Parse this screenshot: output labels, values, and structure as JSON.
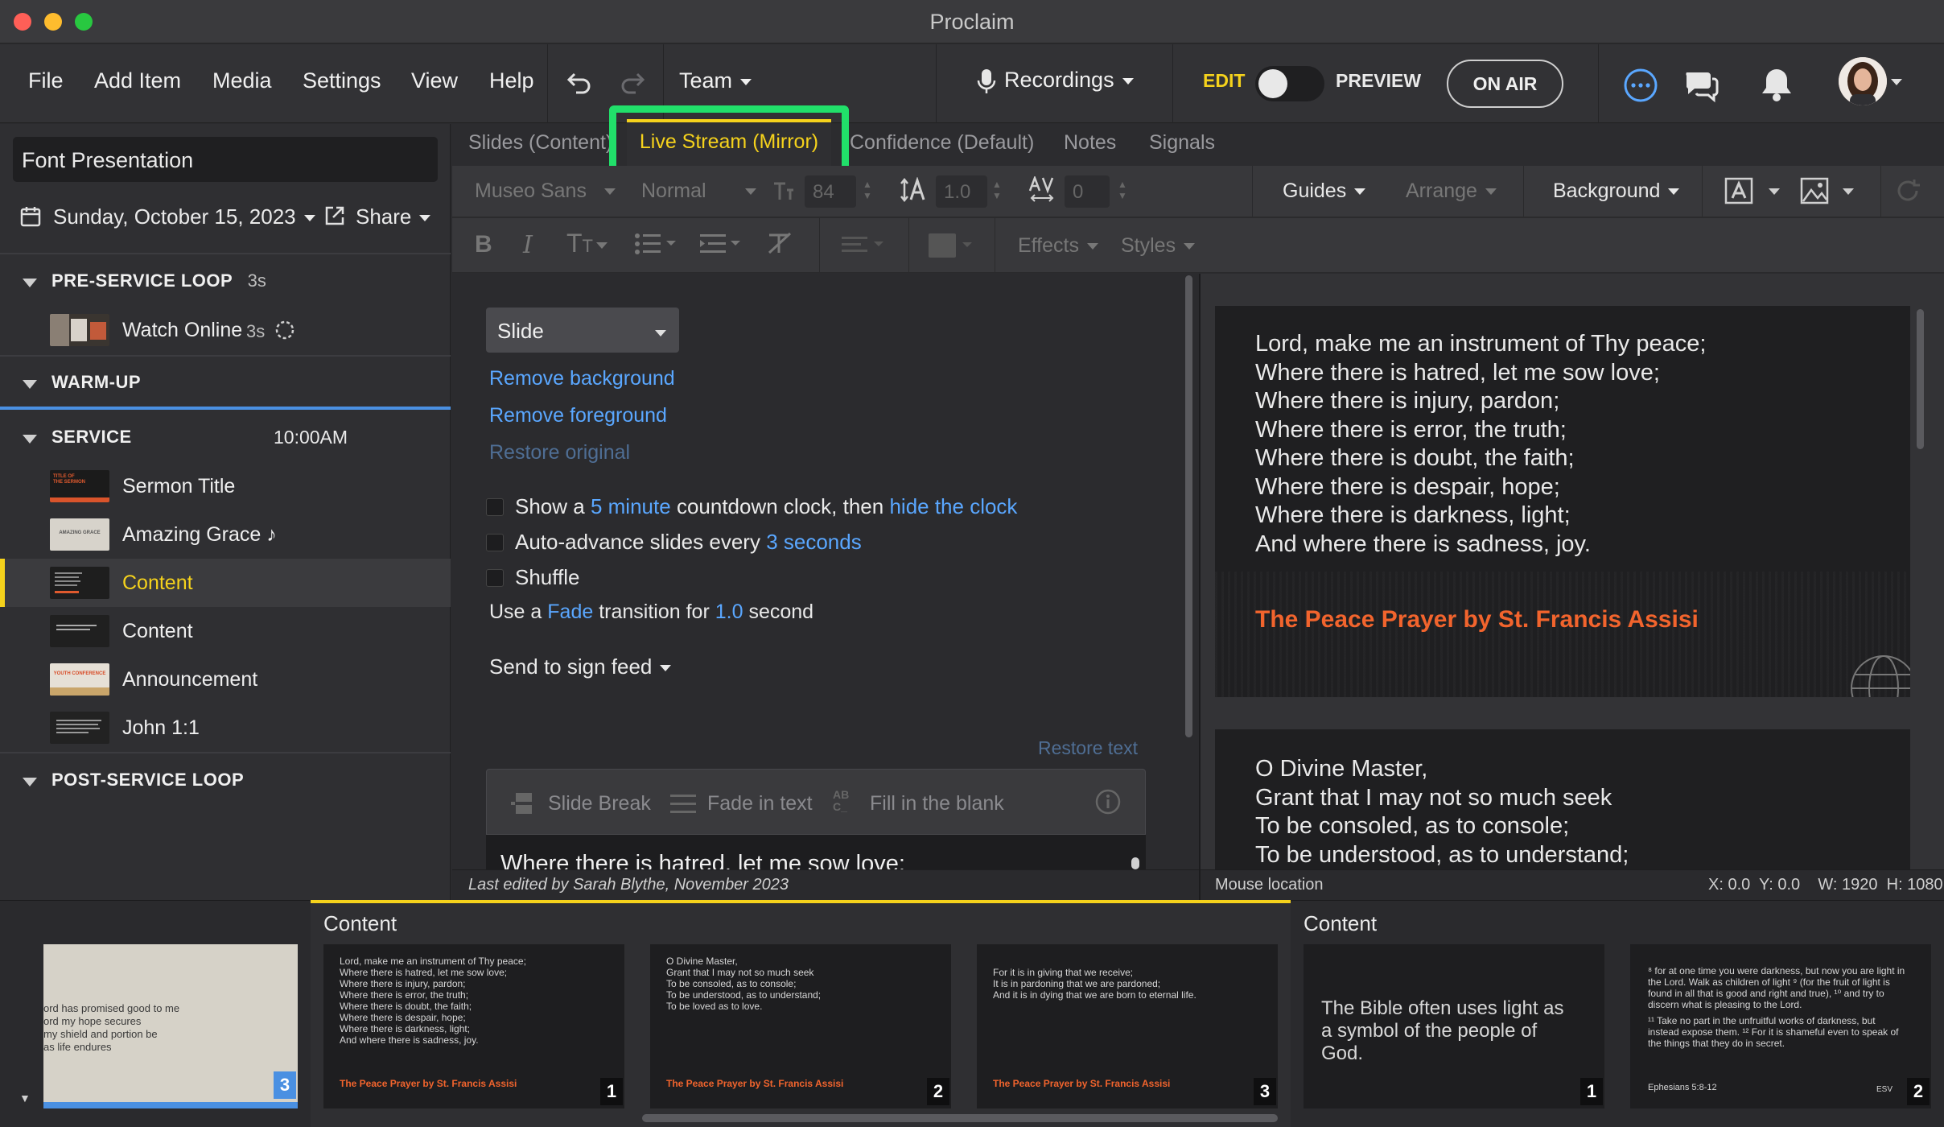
{
  "app": {
    "title": "Proclaim"
  },
  "menu": {
    "file": "File",
    "add_item": "Add Item",
    "media": "Media",
    "settings": "Settings",
    "view": "View",
    "help": "Help",
    "team": "Team",
    "recordings": "Recordings",
    "edit": "EDIT",
    "preview": "PREVIEW",
    "on_air": "ON AIR"
  },
  "colors": {
    "accent_yellow": "#f5d21c",
    "link_blue": "#5aa7ff",
    "on_air_border": "#cfcfcf",
    "highlight_green": "#21e06a",
    "title_orange": "#f2642d"
  },
  "sidebar": {
    "presentation_name": "Font Presentation",
    "date": "Sunday, October 15, 2023",
    "share": "Share",
    "sections": {
      "pre_service": {
        "title": "PRE-SERVICE LOOP",
        "duration": "3s"
      },
      "warm_up": {
        "title": "WARM-UP"
      },
      "service": {
        "title": "SERVICE",
        "time": "10:00AM"
      },
      "post_service": {
        "title": "POST-SERVICE LOOP"
      }
    },
    "pre_service_items": [
      {
        "label": "Watch Online",
        "duration": "3s"
      }
    ],
    "service_items": [
      {
        "label": "Sermon Title"
      },
      {
        "label": "Amazing Grace",
        "badge": "♪"
      },
      {
        "label": "Content"
      },
      {
        "label": "Content"
      },
      {
        "label": "Announcement"
      },
      {
        "label": "John 1:1"
      }
    ],
    "thumb_captions": {
      "sermon": "TITLE OF THE SERMON",
      "grace": "AMAZING GRACE",
      "youth": "YOUTH CONFERENCE"
    }
  },
  "tabs": [
    "Slides (Content)",
    "Live Stream (Mirror)",
    "Confidence (Default)",
    "Notes",
    "Signals"
  ],
  "toolbar": {
    "font": "Museo Sans",
    "weight": "Normal",
    "size": "84",
    "line_height": "1.0",
    "tracking": "0",
    "guides": "Guides",
    "arrange": "Arrange",
    "background": "Background",
    "effects": "Effects",
    "styles": "Styles"
  },
  "editor": {
    "dropdown": "Slide",
    "remove_background": "Remove background",
    "remove_foreground": "Remove foreground",
    "restore_original": "Restore original",
    "countdown": {
      "pre": "Show a",
      "link1": "5 minute",
      "mid": "countdown clock, then",
      "link2": "hide the clock"
    },
    "advance": {
      "pre": "Auto-advance slides every",
      "link": "3 seconds"
    },
    "shuffle": "Shuffle",
    "transition": {
      "pre": "Use a",
      "link1": "Fade",
      "mid": "transition for",
      "link2": "1.0",
      "post": "second"
    },
    "send_sign": "Send to sign feed",
    "restore_text": "Restore text",
    "slide_break": "Slide Break",
    "fade_in_text": "Fade in text",
    "fill_blank": "Fill in the blank",
    "text_preview": "Where there is hatred, let me sow love;"
  },
  "preview": {
    "slide1_lines": [
      "Lord, make me an instrument of Thy peace;",
      "Where there is hatred, let me sow love;",
      "Where there is injury, pardon;",
      "Where there is error, the truth;",
      "Where there is doubt, the faith;",
      "Where there is despair, hope;",
      "Where there is darkness, light;",
      "And where there is sadness, joy."
    ],
    "slide1_title": "The Peace Prayer by St. Francis Assisi",
    "slide2_lines": [
      "O Divine Master,",
      "Grant that I may not so much seek",
      "To be consoled, as to console;",
      "To be understood, as to understand;"
    ]
  },
  "status": {
    "last_edited": "Last edited by Sarah Blythe, November 2023",
    "mouse_location": "Mouse location",
    "coords": "X: 0.0  Y: 0.0    W: 1920  H: 1080"
  },
  "filmstrip": {
    "left_partial": {
      "lines": [
        "ord has promised good to me",
        "ord my hope secures",
        "my shield and portion be",
        "as life endures"
      ],
      "num": "3"
    },
    "group1": {
      "title": "Content",
      "slides": [
        {
          "lines": [
            "Lord, make me an instrument of Thy peace;",
            "Where there is hatred, let me sow love;",
            "Where there is injury, pardon;",
            "Where there is error, the truth;",
            "Where there is doubt, the faith;",
            "Where there is despair, hope;",
            "Where there is darkness, light;",
            "And where there is sadness, joy."
          ],
          "title": "The Peace Prayer by St. Francis Assisi",
          "num": "1"
        },
        {
          "lines": [
            "O Divine Master,",
            "Grant that I may not so much seek",
            "To be consoled, as to console;",
            "To be understood, as to understand;",
            "To be loved as to love."
          ],
          "title": "The Peace Prayer by St. Francis Assisi",
          "num": "2"
        },
        {
          "lines": [
            "For it is in giving that we receive;",
            "It is in pardoning that we are pardoned;",
            "And it is in dying that we are born to eternal life."
          ],
          "title": "The Peace Prayer by St. Francis Assisi",
          "num": "3"
        }
      ]
    },
    "group2": {
      "title": "Content",
      "slides": [
        {
          "text": "The Bible often uses light as a symbol of the people of God.",
          "num": "1"
        },
        {
          "lines": [
            "⁸ for at one time you were darkness, but now you are light in",
            "the Lord. Walk as children of light ⁹ (for the fruit of light is",
            "found in all that is good and right and true), ¹⁰ and try to",
            "discern what is pleasing to the Lord.",
            "",
            "¹¹ Take no part in the unfruitful works of darkness, but",
            "instead expose them. ¹² For it is shameful even to speak of",
            "the things that they do in secret."
          ],
          "ref": "Ephesians 5:8-12",
          "version": "ESV",
          "num": "2"
        }
      ]
    }
  }
}
